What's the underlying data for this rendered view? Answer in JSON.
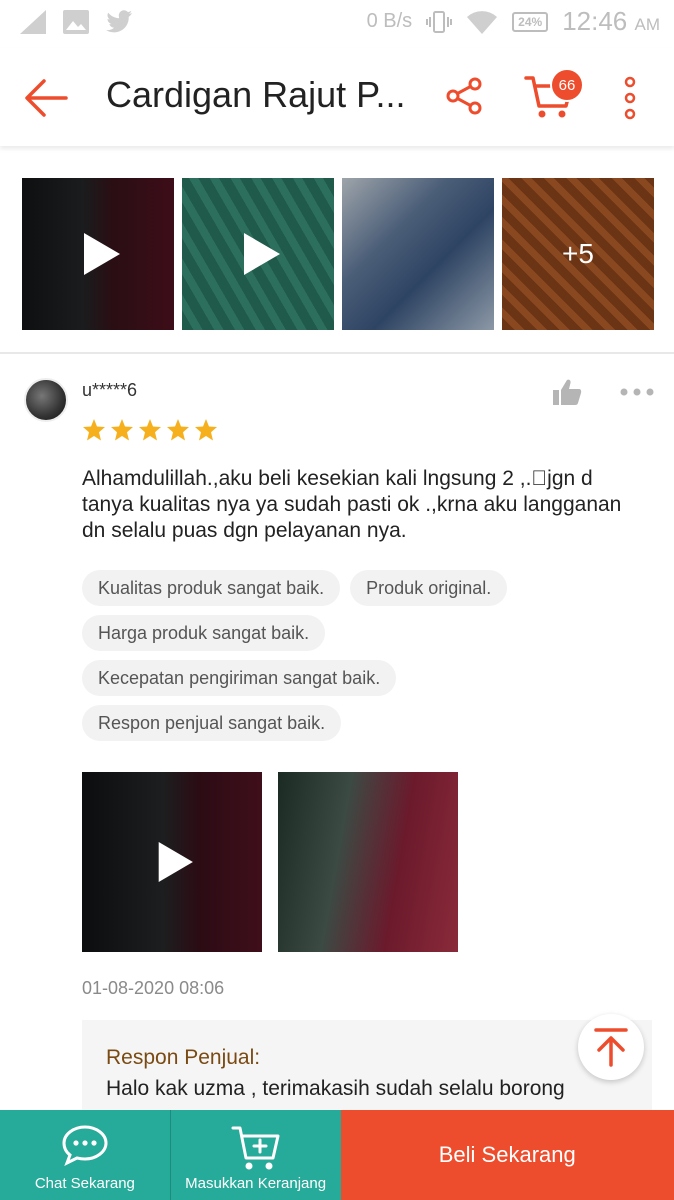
{
  "status_bar": {
    "net_speed": "0 B/s",
    "battery": "24%",
    "time": "12:46",
    "ampm": "AM"
  },
  "header": {
    "title": "Cardigan Rajut P...",
    "cart_count": "66",
    "accent": "#ee4d2d"
  },
  "gallery": {
    "more_count": "+5",
    "items": [
      "video",
      "video",
      "image",
      "image"
    ]
  },
  "review": {
    "username": "u*****6",
    "rating": 5,
    "rating_max": 5,
    "text": "Alhamdulillah.,aku beli kesekian kali lngsung 2 ,.\u0000jgn d tanya kualitas nya ya sudah pasti ok .,krna aku langganan dn selalu puas dgn pelayanan nya.",
    "tags": [
      "Kualitas produk sangat baik.",
      "Produk original.",
      "Harga produk sangat baik.",
      "Kecepatan pengiriman sangat baik.",
      "Respon penjual sangat baik."
    ],
    "date": "01-08-2020 08:06"
  },
  "seller_response": {
    "title": "Respon Penjual:",
    "text": "Halo kak uzma , terimakasih sudah selalu borong"
  },
  "bottom_bar": {
    "chat_label": "Chat Sekarang",
    "cart_label": "Masukkan Keranjang",
    "buy_label": "Beli Sekarang",
    "teal": "#26aa99"
  }
}
